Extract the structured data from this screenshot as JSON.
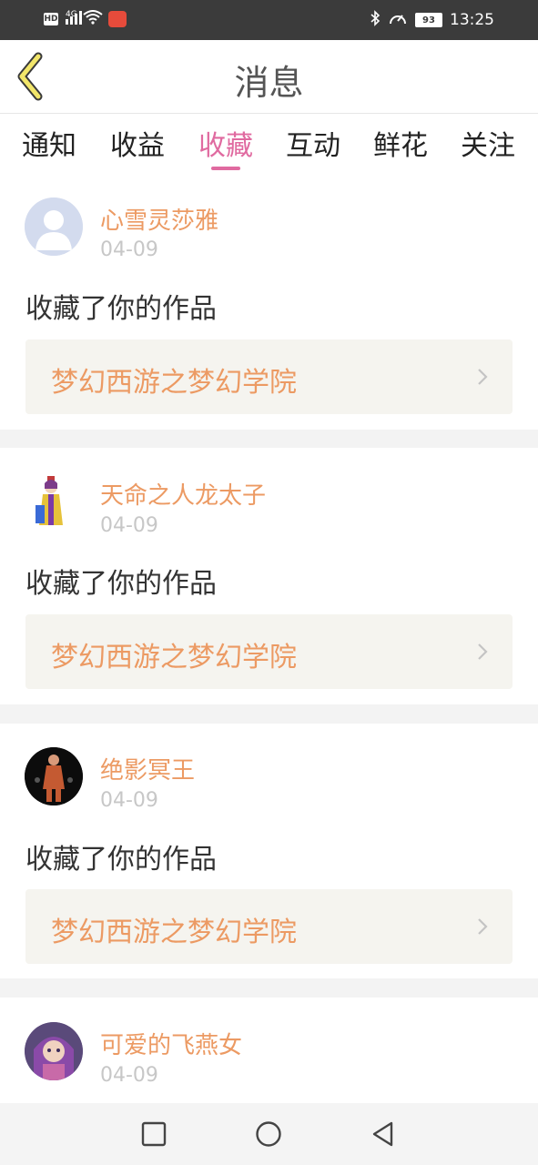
{
  "status_bar": {
    "left_icons": [
      "hd-icon",
      "4g-signal-icon",
      "wifi-icon",
      "app-notification-icon"
    ],
    "hd_label": "HD",
    "network_label": "4G",
    "right_icons": [
      "bluetooth-icon",
      "speed-icon",
      "battery-icon"
    ],
    "battery": "93",
    "time": "13:25"
  },
  "header": {
    "title": "消息",
    "back_icon": "chevron-left-icon"
  },
  "tabs": {
    "items": [
      "通知",
      "收益",
      "收藏",
      "互动",
      "鲜花",
      "关注"
    ],
    "active_index": 2,
    "active_color": "#e06aa0"
  },
  "feed": [
    {
      "user": "心雪灵莎雅",
      "date": "04-09",
      "action": "收藏了你的作品",
      "work": "梦幻西游之梦幻学院",
      "avatar": "default-avatar"
    },
    {
      "user": "天命之人龙太子",
      "date": "04-09",
      "action": "收藏了你的作品",
      "work": "梦幻西游之梦幻学院",
      "avatar": "game-character-avatar"
    },
    {
      "user": "绝影冥王",
      "date": "04-09",
      "action": "收藏了你的作品",
      "work": "梦幻西游之梦幻学院",
      "avatar": "game-character-avatar"
    },
    {
      "user": "可爱的飞燕女",
      "date": "04-09",
      "avatar": "game-character-avatar"
    }
  ],
  "colors": {
    "accent_text": "#ec9a63",
    "tab_active": "#e06aa0",
    "work_box_bg": "#f5f4ef"
  },
  "navbar": {
    "buttons": [
      "recents-square-icon",
      "home-circle-icon",
      "back-triangle-icon"
    ]
  }
}
